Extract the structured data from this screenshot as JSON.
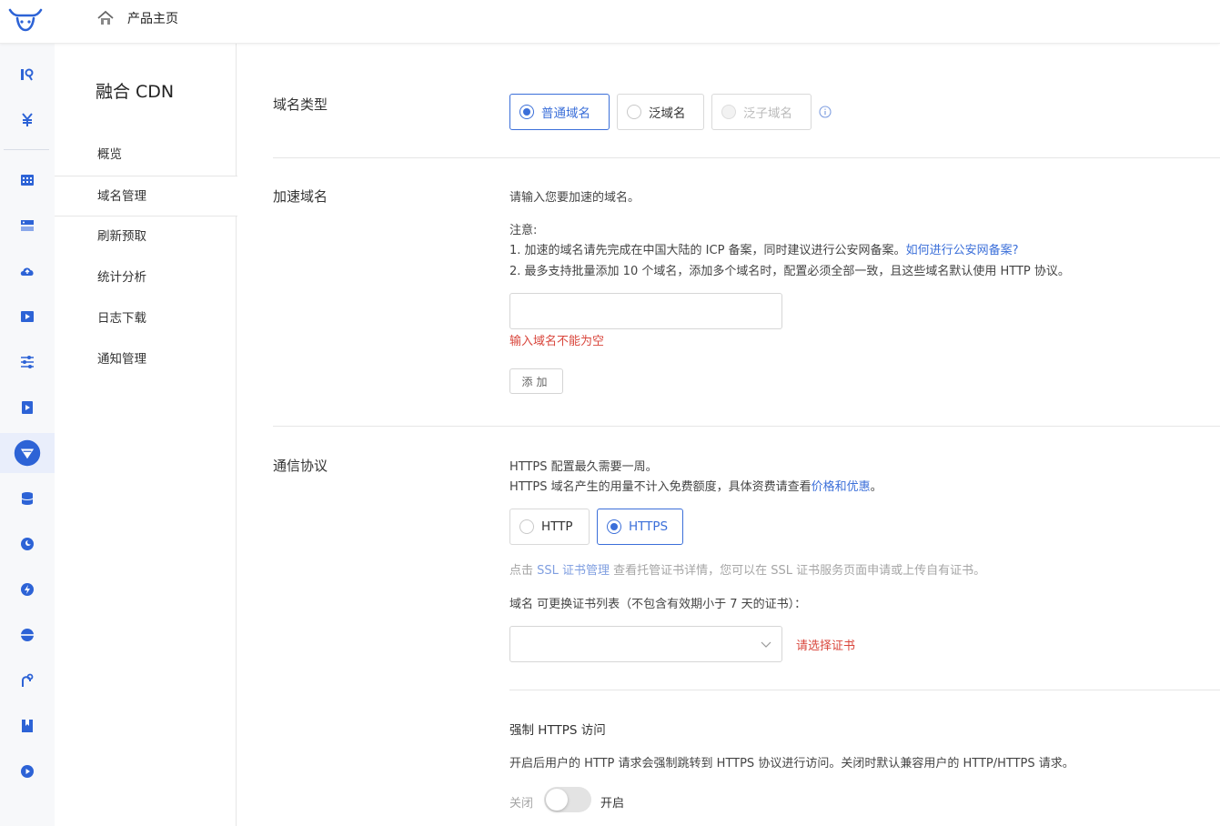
{
  "header": {
    "home_label": "产品主页"
  },
  "sidebar": {
    "title": "融合 CDN",
    "items": [
      {
        "label": "概览"
      },
      {
        "label": "域名管理"
      },
      {
        "label": "刷新预取"
      },
      {
        "label": "统计分析"
      },
      {
        "label": "日志下载"
      },
      {
        "label": "通知管理"
      }
    ]
  },
  "domain_type": {
    "label": "域名类型",
    "options": [
      "普通域名",
      "泛域名",
      "泛子域名"
    ],
    "selected": "普通域名"
  },
  "accel_domain": {
    "label": "加速域名",
    "prompt": "请输入您要加速的域名。",
    "note_title": "注意:",
    "note1": "1. 加速的域名请先完成在中国大陆的 ICP 备案，同时建议进行公安网备案。",
    "note1_link": "如何进行公安网备案?",
    "note2": "2. 最多支持批量添加 10 个域名，添加多个域名时，配置必须全部一致，且这些域名默认使用 HTTP 协议。",
    "input_value": "",
    "error": "输入域名不能为空",
    "add_button": "添加"
  },
  "protocol": {
    "label": "通信协议",
    "line1": "HTTPS 配置最久需要一周。",
    "line2_prefix": "HTTPS 域名产生的用量不计入免费额度，具体资费请查看",
    "line2_link": "价格和优惠",
    "line2_suffix": "。",
    "options": [
      "HTTP",
      "HTTPS"
    ],
    "selected": "HTTPS",
    "cert_hint_prefix": "点击 ",
    "cert_hint_link": "SSL 证书管理",
    "cert_hint_suffix": " 查看托管证书详情，您可以在 SSL 证书服务页面申请或上传自有证书。",
    "cert_list_label": "域名 可更换证书列表（不包含有效期小于 7 天的证书）：",
    "cert_select_value": "",
    "cert_error": "请选择证书"
  },
  "force_https": {
    "title": "强制 HTTPS 访问",
    "description": "开启后用户的 HTTP 请求会强制跳转到 HTTPS 协议进行访问。关闭时默认兼容用户的 HTTP/HTTPS 请求。",
    "off_label": "关闭",
    "on_label": "开启",
    "enabled": false
  },
  "colors": {
    "accent": "#3b6fd9",
    "error": "#d9463c",
    "rail_bg": "#f7f8fa"
  }
}
